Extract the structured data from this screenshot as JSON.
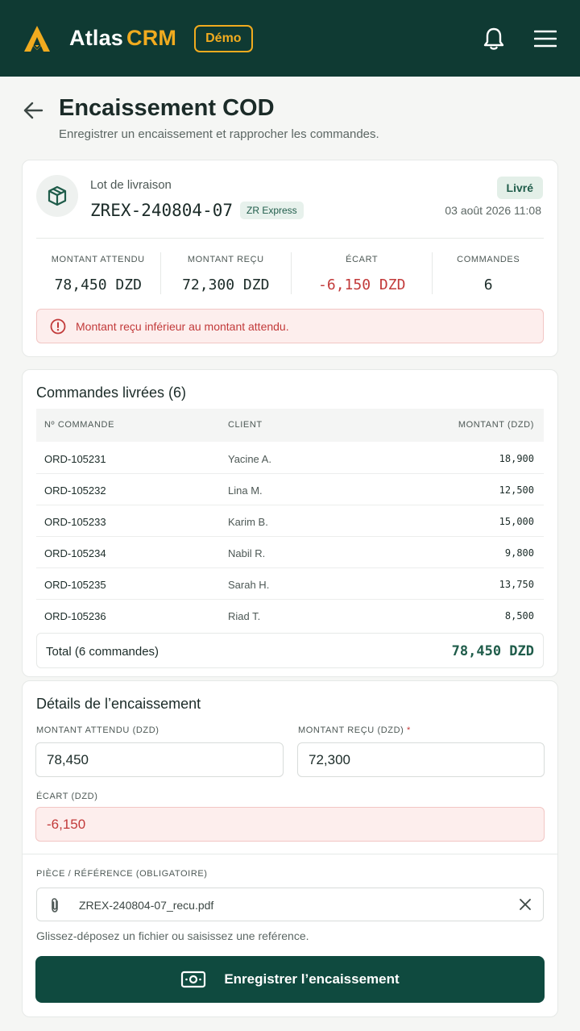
{
  "app": {
    "name": "Atlas",
    "name_accent": "CRM",
    "badge": "Démo"
  },
  "page": {
    "title": "Encaissement COD",
    "subtitle": "Enregistrer un encaissement et rapprocher les commandes."
  },
  "batch": {
    "label": "Lot de livraison",
    "id": "ZREX-240804-07",
    "carrier": "ZR Express",
    "status": "Livré",
    "date": "03 août 2026 11:08",
    "stats": [
      {
        "label": "MONTANT ATTENDU",
        "value": "78,450 DZD"
      },
      {
        "label": "MONTANT REÇU",
        "value": "72,300 DZD"
      },
      {
        "label": "ÉCART",
        "value": "-6,150 DZD"
      },
      {
        "label": "COMMANDES",
        "value": "6"
      }
    ],
    "alert": "Montant reçu inférieur au montant attendu."
  },
  "orders": {
    "title": "Commandes livrées (6)",
    "columns": [
      "Nº COMMANDE",
      "CLIENT",
      "MONTANT (DZD)"
    ],
    "rows": [
      {
        "id": "ORD-105231",
        "client": "Yacine A.",
        "amount": "18,900"
      },
      {
        "id": "ORD-105232",
        "client": "Lina M.",
        "amount": "12,500"
      },
      {
        "id": "ORD-105233",
        "client": "Karim B.",
        "amount": "15,000"
      },
      {
        "id": "ORD-105234",
        "client": "Nabil R.",
        "amount": "9,800"
      },
      {
        "id": "ORD-105235",
        "client": "Sarah H.",
        "amount": "13,750"
      },
      {
        "id": "ORD-105236",
        "client": "Riad T.",
        "amount": "8,500"
      }
    ],
    "total_label": "Total (6 commandes)",
    "total_value": "78,450 DZD"
  },
  "details": {
    "title": "Détails de l’encaissement",
    "expected_label": "MONTANT ATTENDU (DZD)",
    "expected_value": "78,450",
    "received_label": "MONTANT REÇU (DZD)",
    "required_mark": "*",
    "received_value": "72,300",
    "gap_label": "ÉCART (DZD)",
    "gap_value": "-6,150",
    "file_label": "PIÈCE / RÉFÉRENCE (OBLIGATOIRE)",
    "file_name": "ZREX-240804-07_recu.pdf",
    "hint": "Glissez-déposez un fichier ou saisissez une reférence.",
    "submit": "Enregistrer l’encaissement"
  },
  "colors": {
    "header": "#0f3a33",
    "accent": "#f1ab1f",
    "primary": "#0f4a3f",
    "danger": "#c23a3a"
  },
  "icons": [
    "atlas-logo-icon",
    "bell-icon",
    "menu-icon",
    "back-arrow-icon",
    "package-icon",
    "alert-circle-icon",
    "paperclip-icon",
    "close-icon",
    "cash-icon"
  ]
}
